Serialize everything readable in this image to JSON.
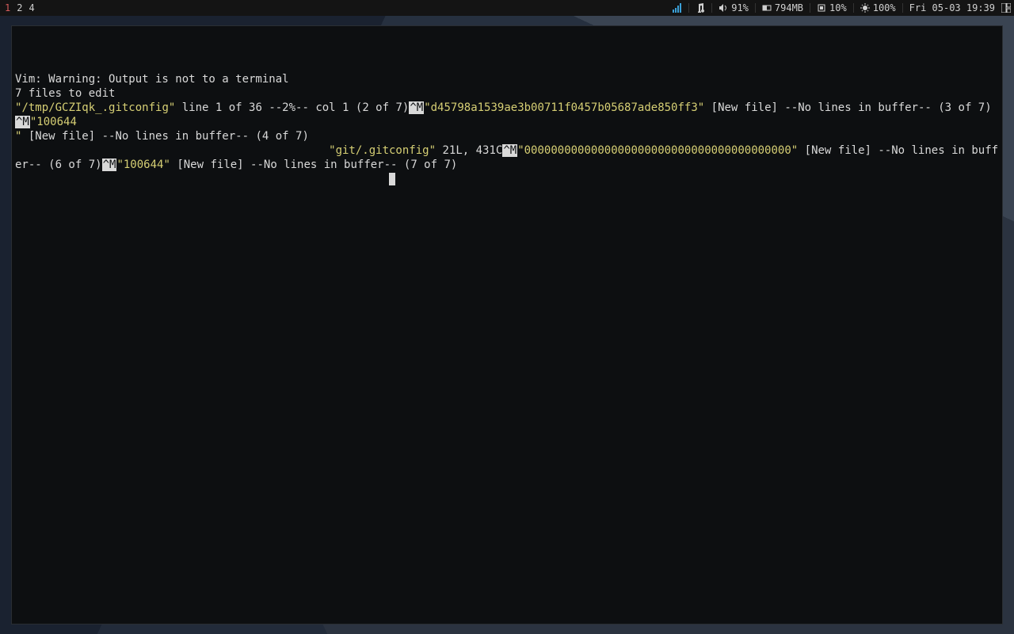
{
  "bar": {
    "tags": [
      "1",
      "2",
      "4"
    ],
    "active_tag_index": 0,
    "volume": "91%",
    "memory": "794MB",
    "cpu": "10%",
    "brightness": "100%",
    "datetime": "Fri 05-03 19:39"
  },
  "terminal": {
    "l1": "Vim: Warning: Output is not to a terminal",
    "l2": "7 files to edit",
    "l3_q1": "\"",
    "l3_path": "/tmp/GCZIqk_.gitconfig",
    "l3_q2": "\"",
    "l3_a": " line 1 of 36 --2%-- col 1 (2 of 7)",
    "l3_cm1": "^M",
    "l3_q3": "\"",
    "l3_hash": "d45798a1539ae3b00711f0457b05687ade850ff3",
    "l3_q4": "\"",
    "l3_b": " [New file] --No lines in buffer-- (3 of 7)",
    "l3_cm2": "^M",
    "l3_q5": "\"",
    "l3_mode": "100644",
    "l4_q1": "\"",
    "l4_a": " [New file] --No lines in buffer-- (4 of 7)",
    "l5_q1": "\"",
    "l5_path": "git/.gitconfig",
    "l5_q2": "\"",
    "l5_a": " 21L, 431C",
    "l5_cm1": "^M",
    "l5_q3": "\"",
    "l5_zeros": "0000000000000000000000000000000000000000",
    "l5_q4": "\"",
    "l5_b": " [New file] --No lines in buffer-- (6 of 7)",
    "l5_cm2": "^M",
    "l5_q5": "\"",
    "l5_mode": "100644",
    "l5_q6": "\"",
    "l5_c": " [New file] --No lines in buffer-- (7 of 7)"
  }
}
